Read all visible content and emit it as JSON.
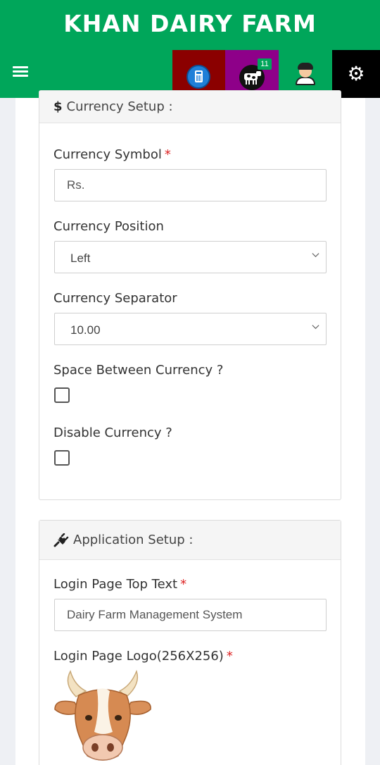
{
  "header": {
    "title": "KHAN DAIRY FARM",
    "menu_icon": "hamburger-icon",
    "nav": {
      "calculator_icon": "calculator-icon",
      "cow_icon": "cow-icon",
      "cow_badge": "11",
      "user_icon": "user-avatar-icon",
      "settings_icon": "gear-icon"
    },
    "colors": {
      "bar": "#00a65a",
      "calc": "#8b0000",
      "cow": "#8e0089",
      "settings": "#000000"
    }
  },
  "currency_setup": {
    "title_icon": "$",
    "title": "Currency Setup :",
    "symbol_label": "Currency Symbol",
    "symbol_value": "Rs.",
    "position_label": "Currency Position",
    "position_value": "Left",
    "separator_label": "Currency Separator",
    "separator_value": "10.00",
    "space_label": "Space Between Currency ?",
    "disable_label": "Disable Currency ?",
    "required_mark": "*"
  },
  "application_setup": {
    "title_icon": "plug-icon",
    "title": "Application Setup :",
    "top_text_label": "Login Page Top Text",
    "top_text_value": "Dairy Farm Management System",
    "logo_label": "Login Page Logo(256X256)",
    "logo_icon": "cow-head-logo"
  }
}
